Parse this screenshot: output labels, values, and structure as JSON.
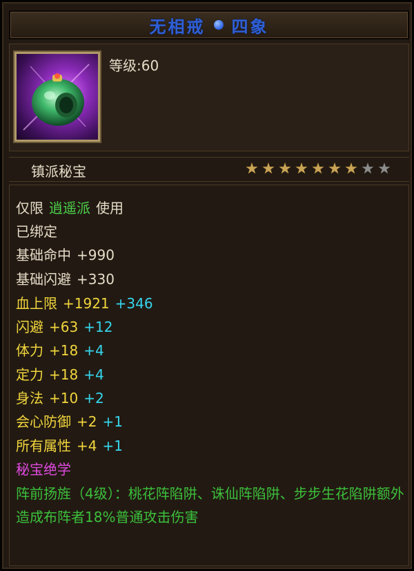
{
  "title": {
    "name": "无相戒",
    "tier": "四象"
  },
  "item": {
    "level_label": "等级:60",
    "rarity": "镇派秘宝",
    "stars_filled": 7,
    "stars_total": 9,
    "icon": "jade-ring-icon"
  },
  "restriction": {
    "prefix": "仅限",
    "sect": "逍遥派",
    "suffix": "使用"
  },
  "bound": "已绑定",
  "base_stats": [
    {
      "name": "基础命中",
      "value": "+990"
    },
    {
      "name": "基础闪避",
      "value": "+330"
    }
  ],
  "stats": [
    {
      "name": "血上限",
      "value": "+1921",
      "bonus": "+346"
    },
    {
      "name": "闪避",
      "value": "+63",
      "bonus": "+12"
    },
    {
      "name": "体力",
      "value": "+18",
      "bonus": "+4"
    },
    {
      "name": "定力",
      "value": "+18",
      "bonus": "+4"
    },
    {
      "name": "身法",
      "value": "+10",
      "bonus": "+2"
    },
    {
      "name": "会心防御",
      "value": "+2",
      "bonus": "+1"
    },
    {
      "name": "所有属性",
      "value": "+4",
      "bonus": "+1"
    }
  ],
  "skill_header": "秘宝绝学",
  "skill_text": "阵前扬旌（4级）：桃花阵陷阱、诛仙阵陷阱、步步生花陷阱额外造成布阵者18%普通攻击伤害",
  "colors": {
    "title": "#2e5fd6",
    "stat_name": "#f2d63d",
    "bonus": "#36d6ee",
    "sect": "#4cd34c",
    "skill_header": "#e04ae0",
    "skill_text": "#3cc03c",
    "star_on": "#c9a455",
    "star_off": "#8c8c8c"
  }
}
